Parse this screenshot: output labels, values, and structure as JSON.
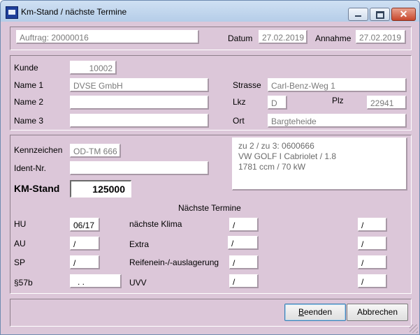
{
  "window": {
    "title": "Km-Stand / nächste Termine"
  },
  "header": {
    "auftrag": "Auftrag: 20000016",
    "datum_label": "Datum",
    "datum_value": "27.02.2019",
    "annahme_label": "Annahme",
    "annahme_value": "27.02.2019"
  },
  "customer": {
    "kunde_label": "Kunde",
    "kunde_value": "10002",
    "name1_label": "Name 1",
    "name1_value": "DVSE GmbH",
    "name2_label": "Name 2",
    "name2_value": "",
    "name3_label": "Name 3",
    "name3_value": "",
    "strasse_label": "Strasse",
    "strasse_value": "Carl-Benz-Weg 1",
    "lkz_label": "Lkz",
    "lkz_value": "D",
    "plz_label": "Plz",
    "plz_value": "22941",
    "ort_label": "Ort",
    "ort_value": "Bargteheide"
  },
  "vehicle": {
    "kennzeichen_label": "Kennzeichen",
    "kennzeichen_value": "OD-TM 666",
    "ident_label": "Ident-Nr.",
    "ident_value": "",
    "km_label": "KM-Stand",
    "km_value": "125000",
    "info_line1": "zu 2 / zu 3: 0600666",
    "info_line2": "VW GOLF I Cabriolet / 1.8",
    "info_line3": "1781 ccm / 70 kW"
  },
  "termine": {
    "heading": "Nächste Termine",
    "hu_label": "HU",
    "hu_value": "06/17",
    "au_label": "AU",
    "au_value": "/",
    "sp_label": "SP",
    "sp_value": "/",
    "s57b_label": "§57b",
    "s57b_value": ". .",
    "klima_label": "nächste Klima",
    "klima_value1": "/",
    "klima_value2": "/",
    "extra_label": "Extra",
    "extra_value1": "/",
    "extra_value2": "/",
    "reifen_label": "Reifenein-/-auslagerung",
    "reifen_value1": "/",
    "reifen_value2": "/",
    "uvv_label": "UVV",
    "uvv_value1": "/",
    "uvv_value2": "/"
  },
  "buttons": {
    "beenden_first": "B",
    "beenden_rest": "eenden",
    "abbrechen_label": "Abbrechen"
  },
  "icons": {
    "app": "app-icon",
    "minimize": "minimize-icon",
    "maximize": "maximize-icon",
    "close": "close-icon",
    "grip": "resize-grip-icon"
  }
}
